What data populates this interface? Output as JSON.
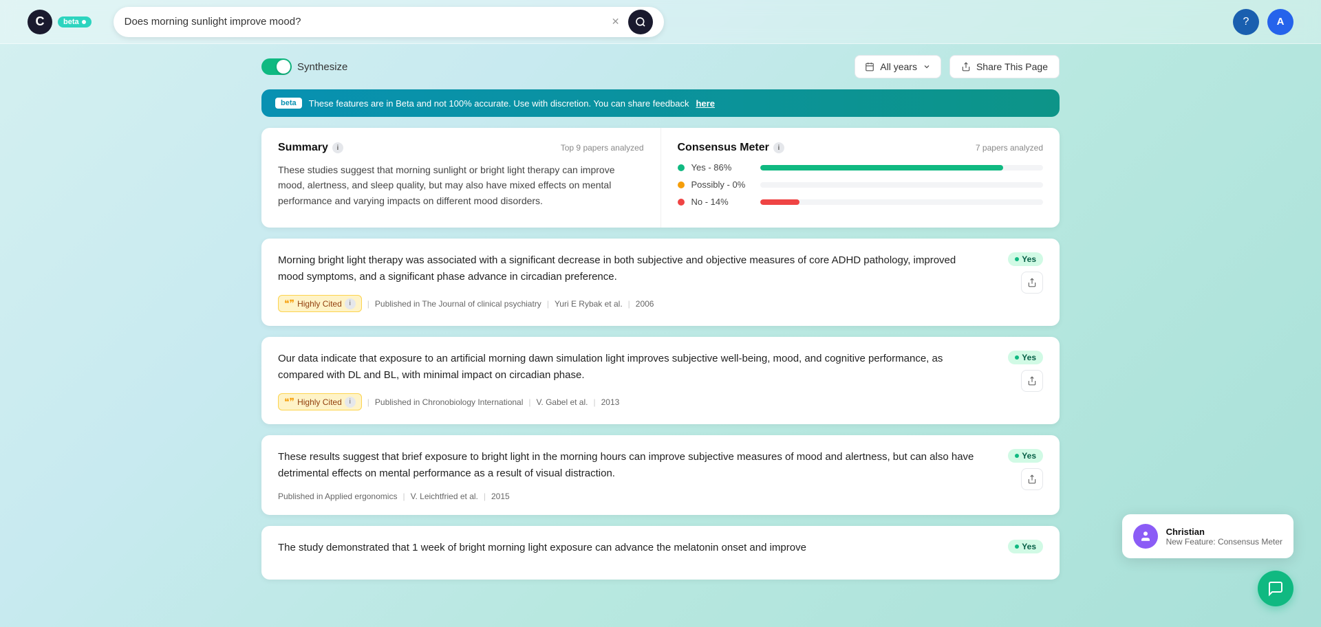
{
  "app": {
    "logo_letter": "C",
    "beta_label": "beta",
    "beta_dot": true
  },
  "search": {
    "query": "Does morning sunlight improve mood?",
    "placeholder": "Does morning sunlight improve mood?"
  },
  "nav": {
    "help_icon": "?",
    "avatar_letter": "A"
  },
  "controls": {
    "synthesize_label": "Synthesize",
    "years_label": "All years",
    "share_label": "Share This Page"
  },
  "banner": {
    "beta_tag": "beta",
    "message": "These features are in Beta and not 100% accurate. Use with discretion. You can share feedback",
    "link_text": "here"
  },
  "summary": {
    "title": "Summary",
    "analyzed_label": "Top 9 papers analyzed",
    "text": "These studies suggest that morning sunlight or bright light therapy can improve mood, alertness, and sleep quality, but may also have mixed effects on mental performance and varying impacts on different mood disorders."
  },
  "consensus": {
    "title": "Consensus Meter",
    "analyzed_label": "7 papers analyzed",
    "items": [
      {
        "label": "Yes - 86%",
        "pct": 86,
        "type": "green"
      },
      {
        "label": "Possibly - 0%",
        "pct": 0,
        "type": "yellow"
      },
      {
        "label": "No - 14%",
        "pct": 14,
        "type": "red"
      }
    ]
  },
  "results": [
    {
      "id": 1,
      "text": "Morning bright light therapy was associated with a significant decrease in both subjective and objective measures of core ADHD pathology, improved mood symptoms, and a significant phase advance in circadian preference.",
      "highly_cited": true,
      "journal": "Published in The Journal of clinical psychiatry",
      "authors": "Yuri E Rybak et al.",
      "year": "2006",
      "verdict": "Yes"
    },
    {
      "id": 2,
      "text": "Our data indicate that exposure to an artificial morning dawn simulation light improves subjective well-being, mood, and cognitive performance, as compared with DL and BL, with minimal impact on circadian phase.",
      "highly_cited": true,
      "journal": "Published in Chronobiology International",
      "authors": "V. Gabel et al.",
      "year": "2013",
      "verdict": "Yes"
    },
    {
      "id": 3,
      "text": "These results suggest that brief exposure to bright light in the morning hours can improve subjective measures of mood and alertness, but can also have detrimental effects on mental performance as a result of visual distraction.",
      "highly_cited": false,
      "journal": "Published in Applied ergonomics",
      "authors": "V. Leichtfried et al.",
      "year": "2015",
      "verdict": "Yes"
    },
    {
      "id": 4,
      "text": "The study demonstrated that 1 week of bright morning light exposure can advance the melatonin onset and improve",
      "highly_cited": false,
      "journal": "",
      "authors": "",
      "year": "",
      "verdict": "Yes"
    }
  ],
  "chat": {
    "name": "Christian",
    "message": "New Feature: Consensus Meter"
  }
}
